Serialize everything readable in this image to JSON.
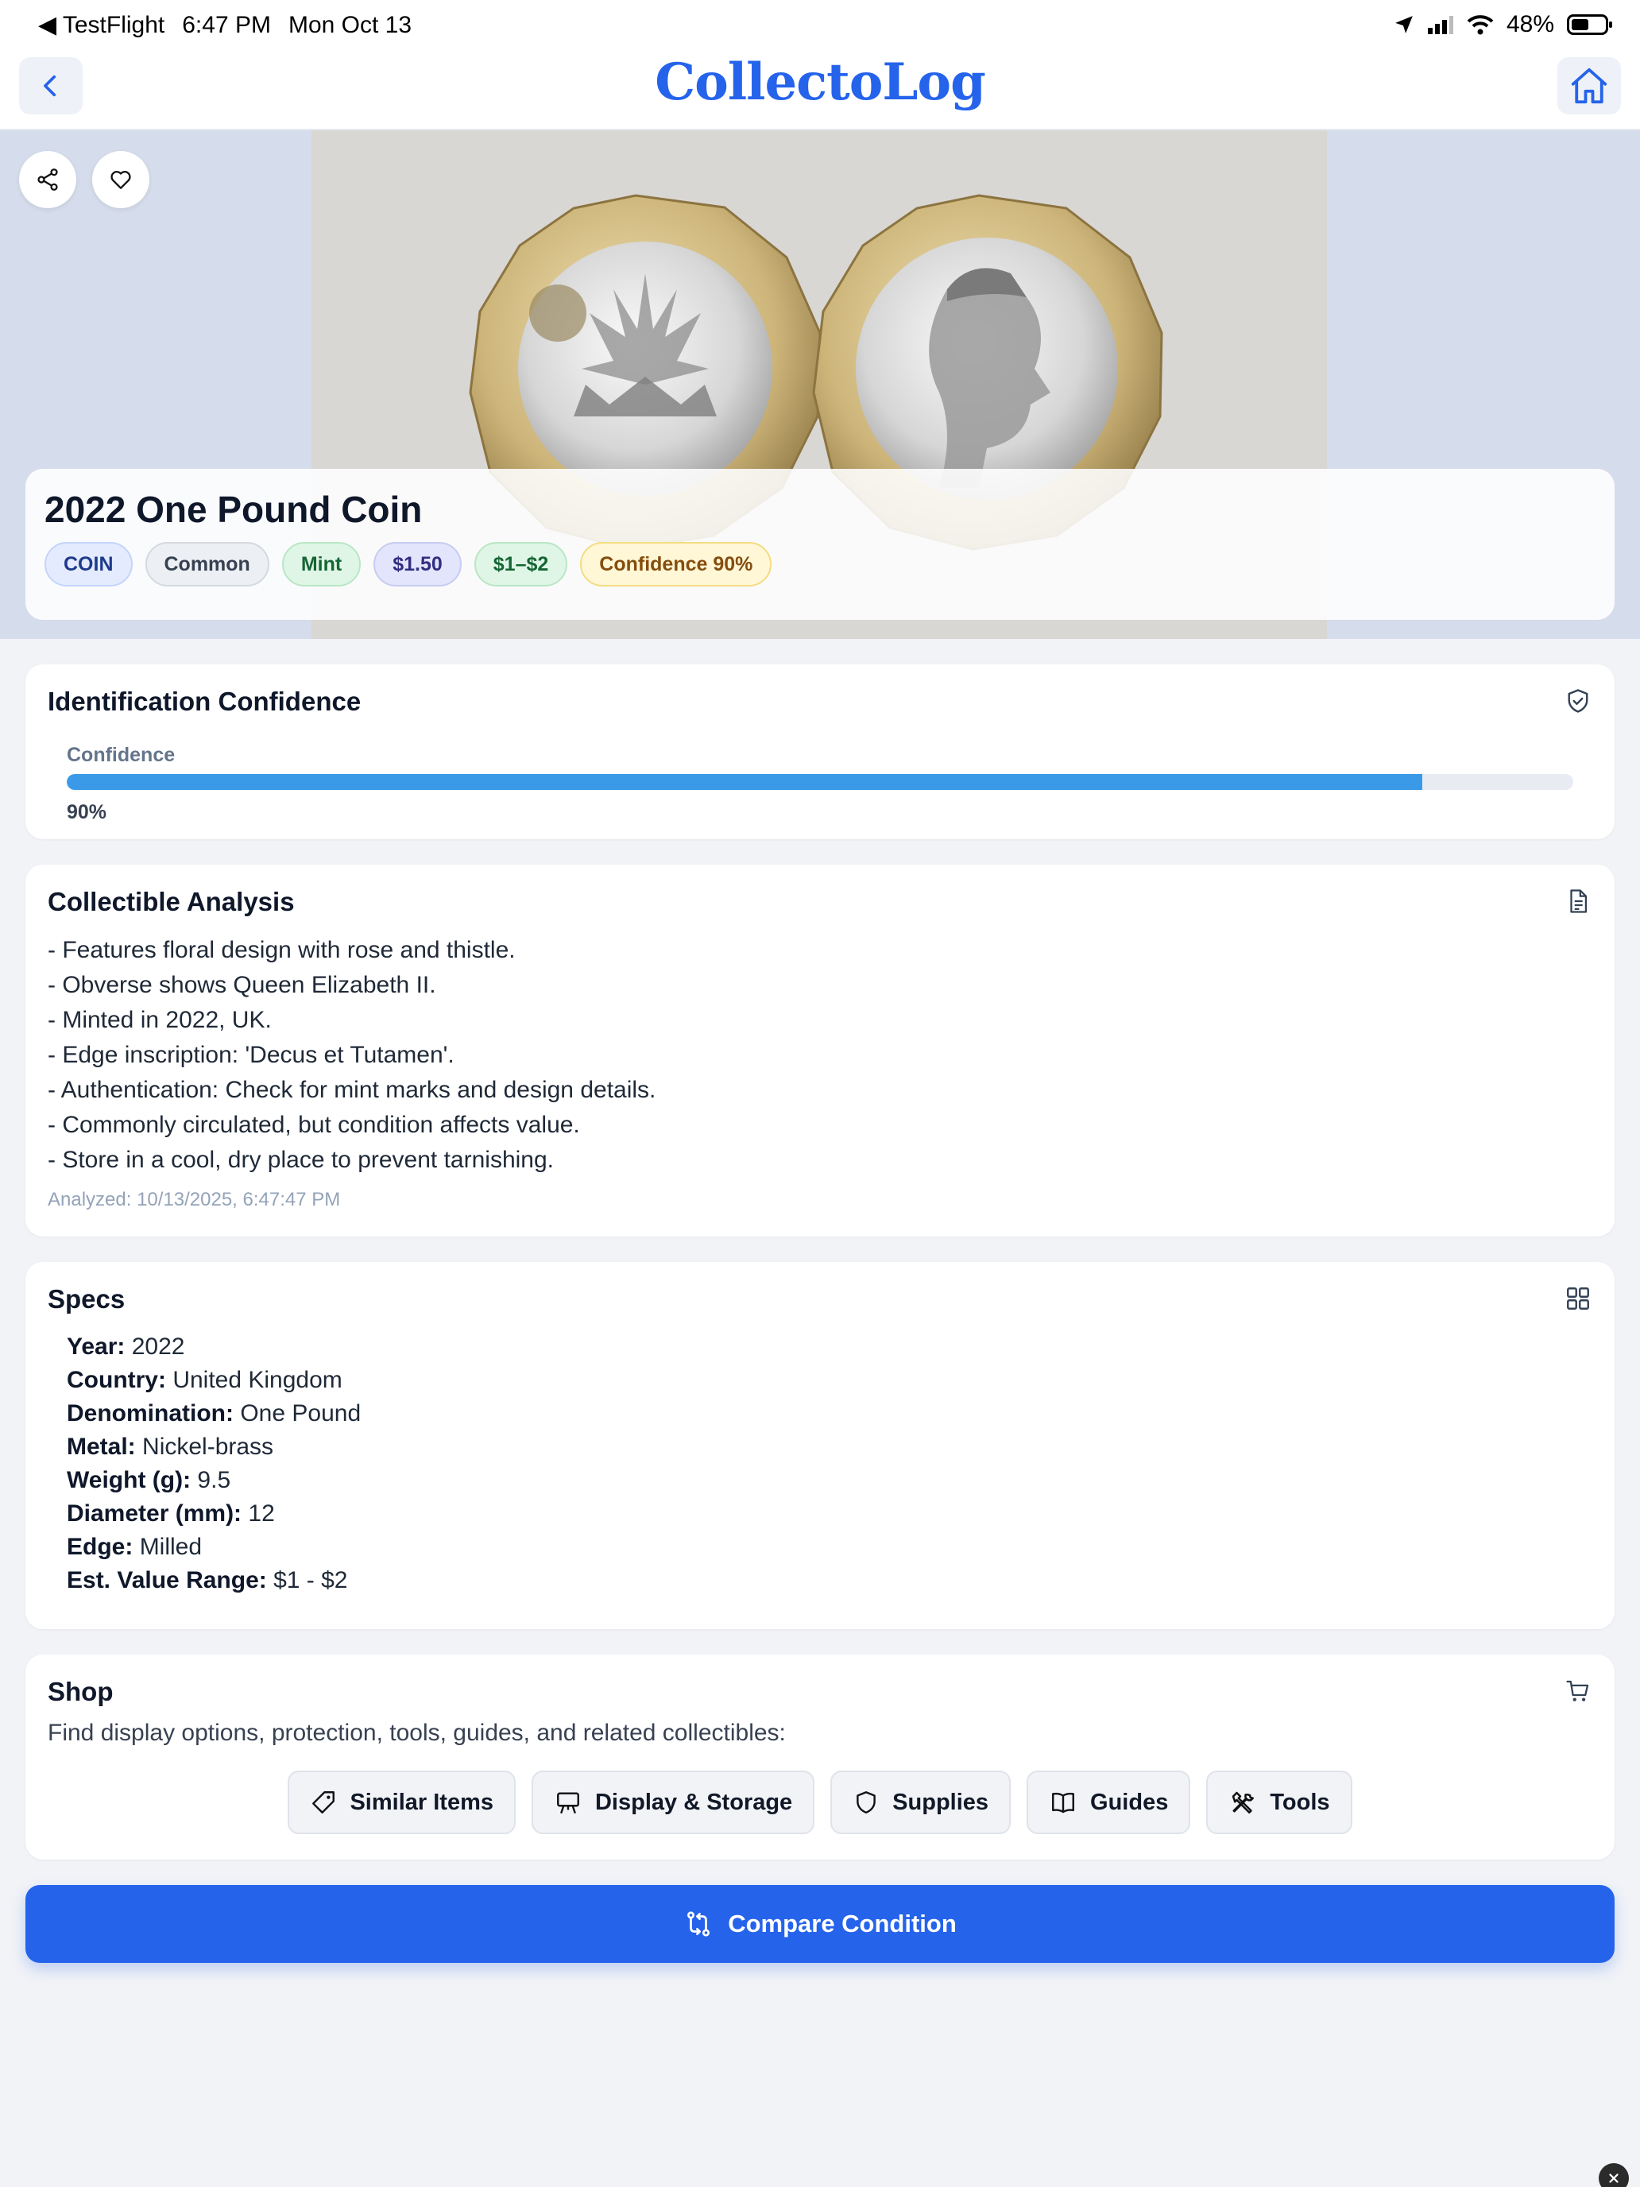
{
  "status_bar": {
    "back_app": "◀ TestFlight",
    "time": "6:47 PM",
    "date": "Mon Oct 13",
    "battery": "48%"
  },
  "nav": {
    "title": "CollectoLog"
  },
  "item": {
    "title": "2022 One Pound Coin",
    "chips": {
      "type": "COIN",
      "rarity": "Common",
      "condition": "Mint",
      "price": "$1.50",
      "range": "$1–$2",
      "confidence": "Confidence 90%"
    }
  },
  "confidence_card": {
    "title": "Identification Confidence",
    "label": "Confidence",
    "value_text": "90%",
    "value": 0.9
  },
  "analysis_card": {
    "title": "Collectible Analysis",
    "lines": [
      "- Features floral design with rose and thistle.",
      "- Obverse shows Queen Elizabeth II.",
      "- Minted in 2022, UK.",
      "- Edge inscription: 'Decus et Tutamen'.",
      "- Authentication: Check for mint marks and design details.",
      "- Commonly circulated, but condition affects value.",
      "- Store in a cool, dry place to prevent tarnishing."
    ],
    "analyzed": "Analyzed: 10/13/2025, 6:47:47 PM"
  },
  "specs_card": {
    "title": "Specs",
    "rows": [
      {
        "label": "Year:",
        "value": "2022"
      },
      {
        "label": "Country:",
        "value": "United Kingdom"
      },
      {
        "label": "Denomination:",
        "value": "One Pound"
      },
      {
        "label": "Metal:",
        "value": "Nickel-brass"
      },
      {
        "label": "Weight (g):",
        "value": "9.5"
      },
      {
        "label": "Diameter (mm):",
        "value": "12"
      },
      {
        "label": "Edge:",
        "value": "Milled"
      },
      {
        "label": "Est. Value Range:",
        "value": "$1 - $2"
      }
    ]
  },
  "shop_card": {
    "title": "Shop",
    "description": "Find display options, protection, tools, guides, and related collectibles:",
    "buttons": {
      "similar": "Similar Items",
      "display": "Display & Storage",
      "supplies": "Supplies",
      "guides": "Guides",
      "tools": "Tools"
    }
  },
  "cta": {
    "label": "Compare Condition"
  },
  "colors": {
    "accent": "#2563eb",
    "progress": "#3b9ae8"
  }
}
